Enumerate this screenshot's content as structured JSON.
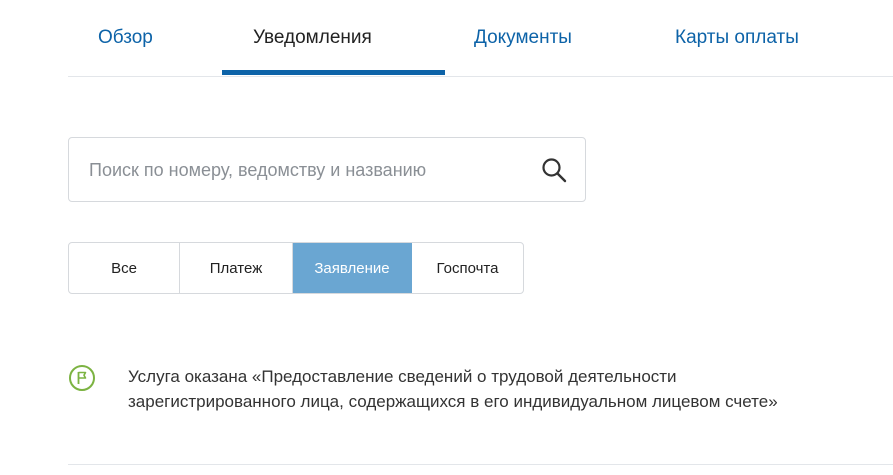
{
  "tabs": [
    {
      "label": "Обзор",
      "active": false
    },
    {
      "label": "Уведомления",
      "active": true
    },
    {
      "label": "Документы",
      "active": false
    },
    {
      "label": "Карты оплаты",
      "active": false
    }
  ],
  "search": {
    "placeholder": "Поиск по номеру, ведомству и названию",
    "value": ""
  },
  "filters": [
    {
      "label": "Все",
      "active": false
    },
    {
      "label": "Платеж",
      "active": false
    },
    {
      "label": "Заявление",
      "active": true
    },
    {
      "label": "Госпочта",
      "active": false
    }
  ],
  "notifications": [
    {
      "icon": "flag-icon",
      "text": "Услуга оказана «Предоставление сведений о трудовой деятельности зарегистрированного лица, содержащихся в его индивидуальном лицевом счете»"
    }
  ],
  "colors": {
    "accent": "#0d63a8",
    "active_filter": "#6aa6d2",
    "status_green": "#7cb342"
  }
}
